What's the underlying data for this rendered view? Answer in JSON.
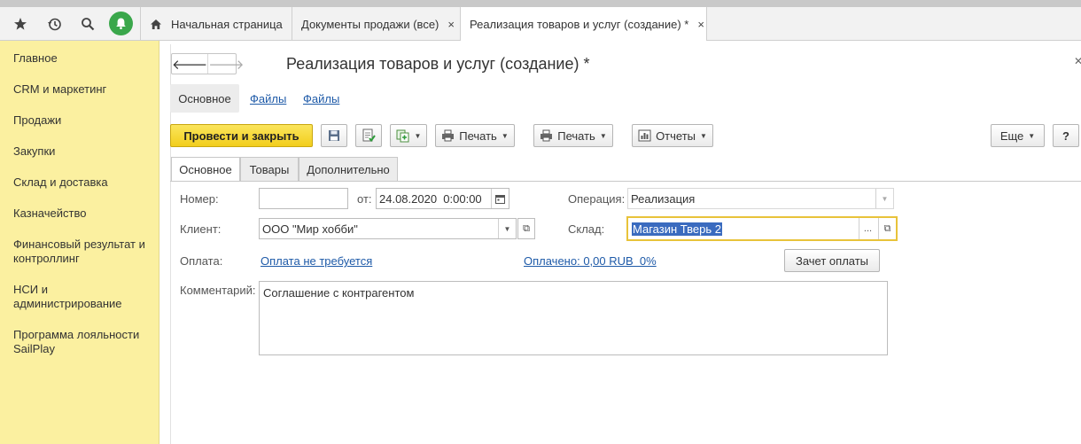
{
  "topbar": {
    "icons": [
      "star-icon",
      "history-icon",
      "search-icon",
      "bell-icon",
      "home-icon"
    ],
    "tabs": [
      {
        "label": "Начальная страница"
      },
      {
        "label": "Документы продажи (все)",
        "close": "×"
      },
      {
        "label": "Реализация товаров и услуг (создание) *",
        "close": "×"
      }
    ]
  },
  "sidebar": {
    "items": [
      {
        "label": "Главное"
      },
      {
        "label": "CRM и маркетинг"
      },
      {
        "label": "Продажи"
      },
      {
        "label": "Закупки"
      },
      {
        "label": "Склад и доставка"
      },
      {
        "label": "Казначейство"
      },
      {
        "label": "Финансовый результат и контроллинг"
      },
      {
        "label": "НСИ и администрирование"
      },
      {
        "label": "Программа лояльности SailPlay"
      }
    ]
  },
  "form": {
    "title": "Реализация товаров и услуг (создание) *",
    "subtabs": [
      "Основное",
      "Файлы",
      "Файлы"
    ],
    "toolbar": {
      "post_close": "Провести и закрыть",
      "print1": "Печать",
      "print2": "Печать",
      "reports": "Отчеты",
      "more": "Еще",
      "help": "?"
    },
    "tabs": [
      "Основное",
      "Товары",
      "Дополнительно"
    ],
    "fields": {
      "number_label": "Номер:",
      "number_value": "",
      "from_label": "от:",
      "date_value": "24.08.2020  0:00:00",
      "operation_label": "Операция:",
      "operation_value": "Реализация",
      "client_label": "Клиент:",
      "client_value": "ООО \"Мир хобби\"",
      "warehouse_label": "Склад:",
      "warehouse_value": "Магазин Тверь 2",
      "warehouse_more": "...",
      "payment_label": "Оплата:",
      "payment_link": "Оплата не требуется",
      "paid_link": "Оплачено: 0,00 RUB  0%",
      "offset_button": "Зачет оплаты",
      "comment_label": "Комментарий:",
      "comment_value": "Соглашение с контрагентом"
    }
  },
  "colors": {
    "sidebar_bg": "#fbf0a0",
    "primary_button": "#f2ce1c",
    "link": "#1e5aa8",
    "active_field_border": "#e8c33a",
    "bell_bg": "#3aa74b"
  }
}
